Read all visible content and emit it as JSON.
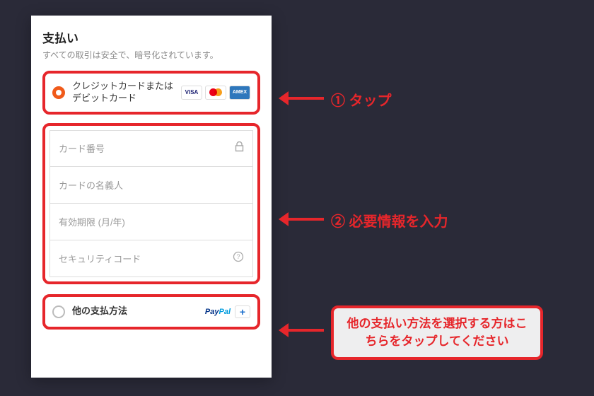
{
  "header": {
    "title": "支払い",
    "subtitle": "すべての取引は安全で、暗号化されています。"
  },
  "paymentOptions": {
    "credit": {
      "label": "クレジットカードまたはデビットカード",
      "logos": {
        "visa": "VISA",
        "amex": "AMEX"
      }
    },
    "other": {
      "label": "他の支払方法",
      "plus": "+"
    }
  },
  "fields": {
    "cardNumber": "カード番号",
    "cardHolder": "カードの名義人",
    "expiry": "有効期限 (月/年)",
    "cvc": "セキュリティコード"
  },
  "annotations": {
    "step1": "① タップ",
    "step2": "② 必要情報を入力",
    "step3": "他の支払い方法を選択する方はこちらをタップしてください"
  }
}
